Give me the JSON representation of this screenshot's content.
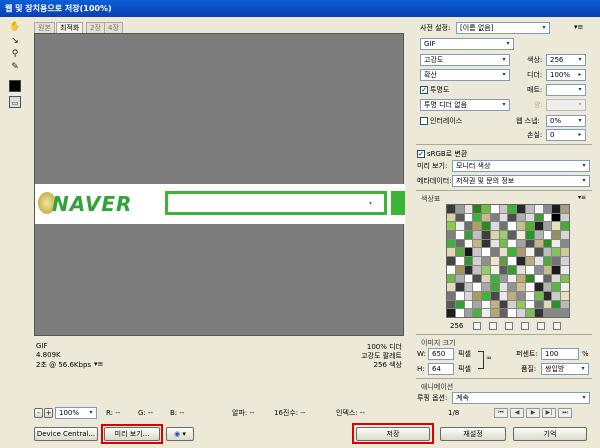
{
  "window": {
    "title": "웹 및 장치용으로 저장(100%)"
  },
  "tabs": [
    "원본",
    "최적화",
    "2장",
    "4장"
  ],
  "canvas": {
    "logo_text": "NAVER"
  },
  "info_left": [
    "GIF",
    "4.809K",
    "2초 @ 56.6Kbps"
  ],
  "info_right": [
    "100% 디더",
    "고강도 팔레트",
    "256 색상"
  ],
  "status": {
    "zoom": "100%",
    "r": "R: --",
    "g": "G: --",
    "b": "B: --",
    "alpha": "알파: --",
    "hex": "16진수: --",
    "index": "인덱스: --"
  },
  "buttons": {
    "device_central": "Device Central...",
    "preview": "미리 보기...",
    "save": "저장",
    "reset": "재설정",
    "remember": "기억"
  },
  "settings": {
    "preset_label": "사전 설정:",
    "preset_value": "[이름 없음]",
    "format": "GIF",
    "reduction": "고강도",
    "colors_label": "색상:",
    "colors_value": "256",
    "dither_algo": "확산",
    "dither_label": "디더:",
    "dither_value": "100%",
    "transparency_label": "투명도",
    "matte_label": "매트:",
    "matte_value": "",
    "no_trans_dither": "투명 디더 없음",
    "amount_label": "양:",
    "amount_value": "",
    "interlaced_label": "인터레이스",
    "websnap_label": "웹 스냅:",
    "websnap_value": "0%",
    "lossy_label": "손실:",
    "lossy_value": "0",
    "srgb_label": "sRGB로 변환",
    "preview_label": "미리 보기:",
    "preview_value": "모니터 색상",
    "metadata_label": "메타데이터:",
    "metadata_value": "저작권 및 문의 정보"
  },
  "color_table": {
    "label": "색상표",
    "count": "256"
  },
  "image_size": {
    "label": "이미지 크기",
    "w_label": "W:",
    "w_value": "650",
    "w_unit": "픽셀",
    "h_label": "H:",
    "h_value": "64",
    "h_unit": "픽셀",
    "percent_label": "퍼센트:",
    "percent_value": "100",
    "percent_unit": "%",
    "quality_label": "품질:",
    "quality_value": "쌍입방"
  },
  "animation": {
    "label": "애니메이션",
    "loop_label": "루핑 옵션:",
    "loop_value": "계속",
    "frame": "1/8"
  },
  "colors": {
    "accent_red": "#d00000",
    "naver_green": "#3cb436",
    "title_blue": "#0a5fd8"
  },
  "palette_colors": [
    "#3a3a3a",
    "#9a9a9a",
    "#e6e6e6",
    "#2f7f1c",
    "#6fbf3c",
    "#ffffff",
    "#c9c9c9",
    "#3cb436",
    "#2a2a2a",
    "#bcbcbc",
    "#f4f4f4",
    "#8a8a8a",
    "#1d1d1d",
    "#a6a07c",
    "#d8d0a0",
    "#595959",
    "#ffffff",
    "#3cb436",
    "#c7b98a",
    "#7f7f7f",
    "#e0e0e0",
    "#4b4b4b",
    "#aeaeae",
    "#dcdcdc",
    "#40973a",
    "#ffffff",
    "#000000",
    "#cfcfcf",
    "#8cc84a",
    "#efefef",
    "#6d6d6d",
    "#b29f62",
    "#2b8a22",
    "#dadada",
    "#737373",
    "#ffffff",
    "#c6bd90",
    "#55b030",
    "#202020",
    "#9f9f9f",
    "#e9e1bb",
    "#4aa838",
    "#808080",
    "#ffffff",
    "#36a030",
    "#c0c0c0",
    "#3f3f3f",
    "#dad4ac",
    "#9ccf6a",
    "#5e5e5e",
    "#f0ecd8",
    "#279a22",
    "#b5b5b5",
    "#ffffff",
    "#9b8f5e",
    "#d6d6d6",
    "#3cb436",
    "#696969",
    "#f8f8f8",
    "#c4b680",
    "#333333",
    "#e3e3e3",
    "#72be4c",
    "#ffffff",
    "#a3a3a3",
    "#4f4f4f",
    "#bfb588",
    "#2d8e24",
    "#ececec",
    "#878787",
    "#dfd8b4",
    "#5aaa3c",
    "#161616",
    "#c8c8c8",
    "#ffffff",
    "#7c7c7c",
    "#e8e2c4",
    "#3cb436",
    "#a99d6c",
    "#f2f2f2",
    "#525252",
    "#bdbdbd",
    "#86c25a",
    "#d2c898",
    "#444444",
    "#ffffff",
    "#31982a",
    "#d0d0d0",
    "#8f8f8f",
    "#ece6cc",
    "#659c40",
    "#ffffff",
    "#262626",
    "#b8ae7e",
    "#e5e5e5",
    "#48ad36",
    "#747474",
    "#d4d4d4",
    "#ffffff",
    "#a1955f",
    "#2e2e2e",
    "#c2c2c2",
    "#96cc66",
    "#f6f2e2",
    "#5c5c5c",
    "#3a9a2e",
    "#dedede",
    "#ffffff",
    "#8d8d8d",
    "#cabc8a",
    "#1a1a1a",
    "#ebebeb",
    "#6aba44",
    "#b0b0b0",
    "#ffffff",
    "#4d4d4d",
    "#dcd5ae",
    "#3cb436",
    "#9c9c9c",
    "#f0f0f0",
    "#bfae74",
    "#2a8a20",
    "#ffffff",
    "#666666",
    "#d9d9d9",
    "#7fc054",
    "#e2dcbc",
    "#383838",
    "#c5c5c5",
    "#ffffff",
    "#a8a8a8",
    "#42a834",
    "#e4e4e4",
    "#939393",
    "#cfc492",
    "#ffffff",
    "#242424",
    "#b3b3b3",
    "#5db63e",
    "#f3efdc",
    "#777777",
    "#ffffff",
    "#d7d7d7",
    "#ab9c64",
    "#3cb436",
    "#4a4a4a",
    "#eaeaea",
    "#b9b07e",
    "#8b8b8b",
    "#ffffff",
    "#6fc04a",
    "#2c2c2c",
    "#cccccc",
    "#e7e0c0",
    "#5a5a5a",
    "#34a02c",
    "#ffffff",
    "#a5a5a5",
    "#f5f5f5",
    "#c0b37e",
    "#404040",
    "#d1d1d1",
    "#90c860",
    "#ffffff",
    "#707070",
    "#e1dab8",
    "#2b922a",
    "#bababa",
    "#1e1e1e",
    "#ffffff",
    "#9e9e9e",
    "#4cb03a",
    "#ededed",
    "#b6a872",
    "#626262",
    "#ffffff",
    "#d5d5d5",
    "#7ebc52",
    "#353535"
  ]
}
